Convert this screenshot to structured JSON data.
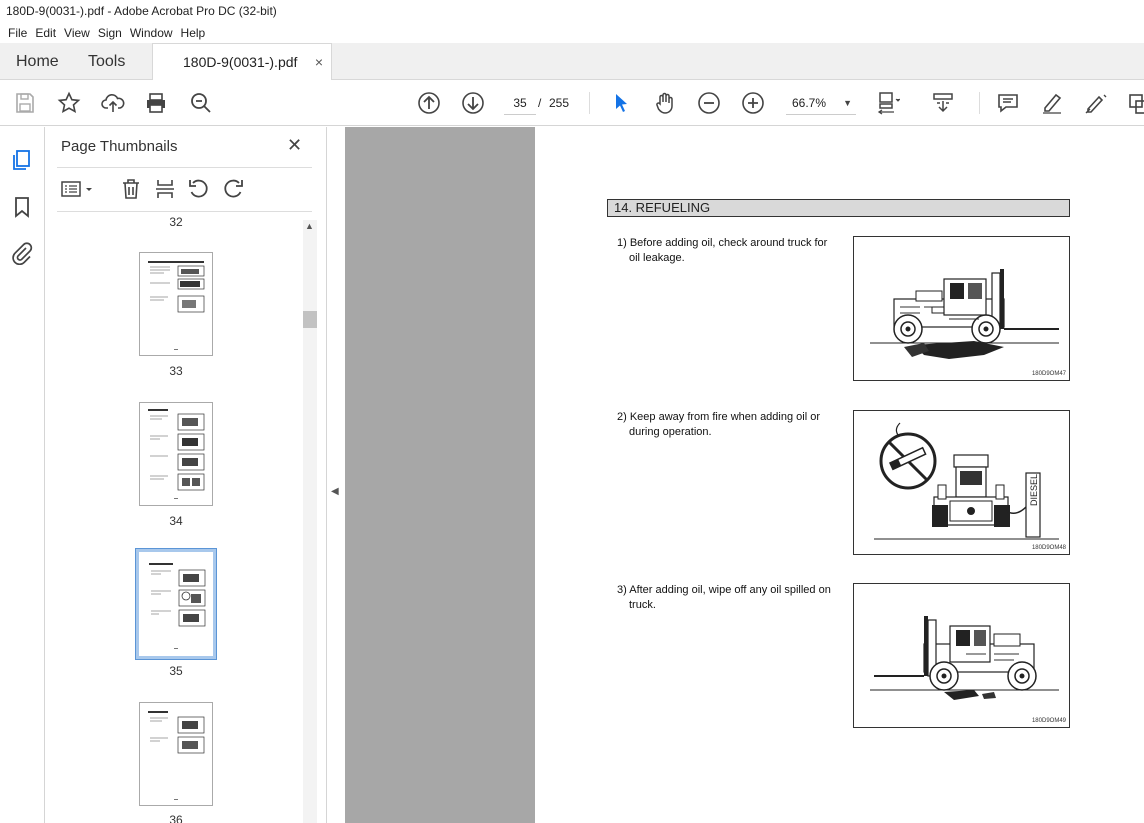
{
  "window": {
    "title": "180D-9(0031-).pdf - Adobe Acrobat Pro DC (32-bit)"
  },
  "menu": [
    "File",
    "Edit",
    "View",
    "Sign",
    "Window",
    "Help"
  ],
  "tabs": {
    "home": "Home",
    "tools": "Tools",
    "document": "180D-9(0031-).pdf",
    "close": "×"
  },
  "toolbar": {
    "current_page": "35",
    "separator": "/",
    "total_pages": "255",
    "zoom": "66.7%"
  },
  "panel": {
    "title": "Page Thumbnails",
    "close": "✕",
    "thumbnails": [
      {
        "label": "32"
      },
      {
        "label": "33"
      },
      {
        "label": "34"
      },
      {
        "label": "35",
        "selected": true
      },
      {
        "label": "36"
      }
    ]
  },
  "document": {
    "section": "14. REFUELING",
    "steps": [
      {
        "text": "1) Before adding oil, check around truck for oil leakage.",
        "figure_code": "180D9OM47"
      },
      {
        "text": "2) Keep away from fire when adding oil or during operation.",
        "figure_code": "180D9OM48",
        "sign": "DIESEL"
      },
      {
        "text": "3) After adding oil, wipe off any oil spilled on truck.",
        "figure_code": "180D9OM49"
      }
    ]
  },
  "colors": {
    "accent": "#1473e6",
    "viewer_bg": "#a7a7a7",
    "selected_border": "#5b95d6"
  }
}
